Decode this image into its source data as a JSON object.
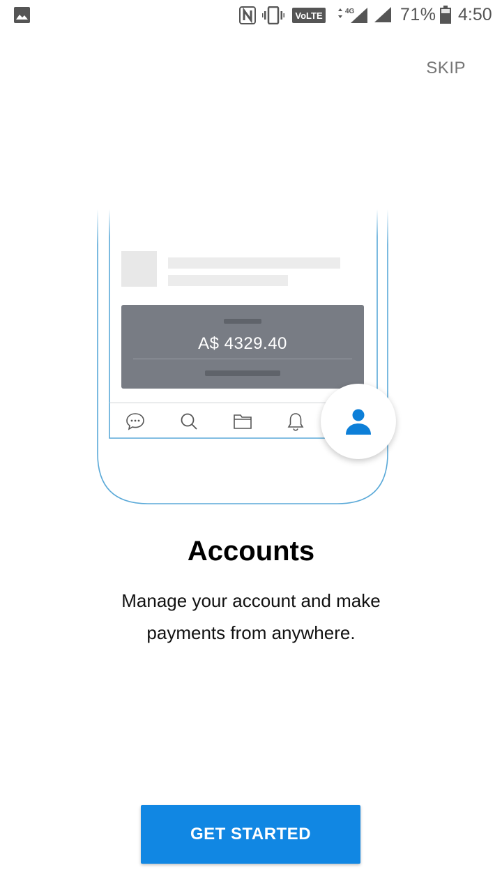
{
  "status_bar": {
    "battery_percent": "71%",
    "time": "4:50",
    "network": "4G",
    "volte": "VoLTE",
    "icons": [
      "gallery-icon",
      "nfc-icon",
      "vibrate-icon",
      "volte-icon",
      "4g-data-icon",
      "signal-icon",
      "battery-icon"
    ]
  },
  "header": {
    "skip_label": "SKIP"
  },
  "illustration": {
    "balance_amount": "A$ 4329.40",
    "nav_icons": [
      "chat-icon",
      "search-icon",
      "folder-icon",
      "bell-icon",
      "account-icon"
    ]
  },
  "onboarding": {
    "title": "Accounts",
    "description": "Manage your account and make payments from anywhere."
  },
  "footer": {
    "cta_label": "GET STARTED"
  },
  "colors": {
    "primary": "#1187e3",
    "card": "#787c84",
    "phone_outline": "#5aa9d8"
  }
}
